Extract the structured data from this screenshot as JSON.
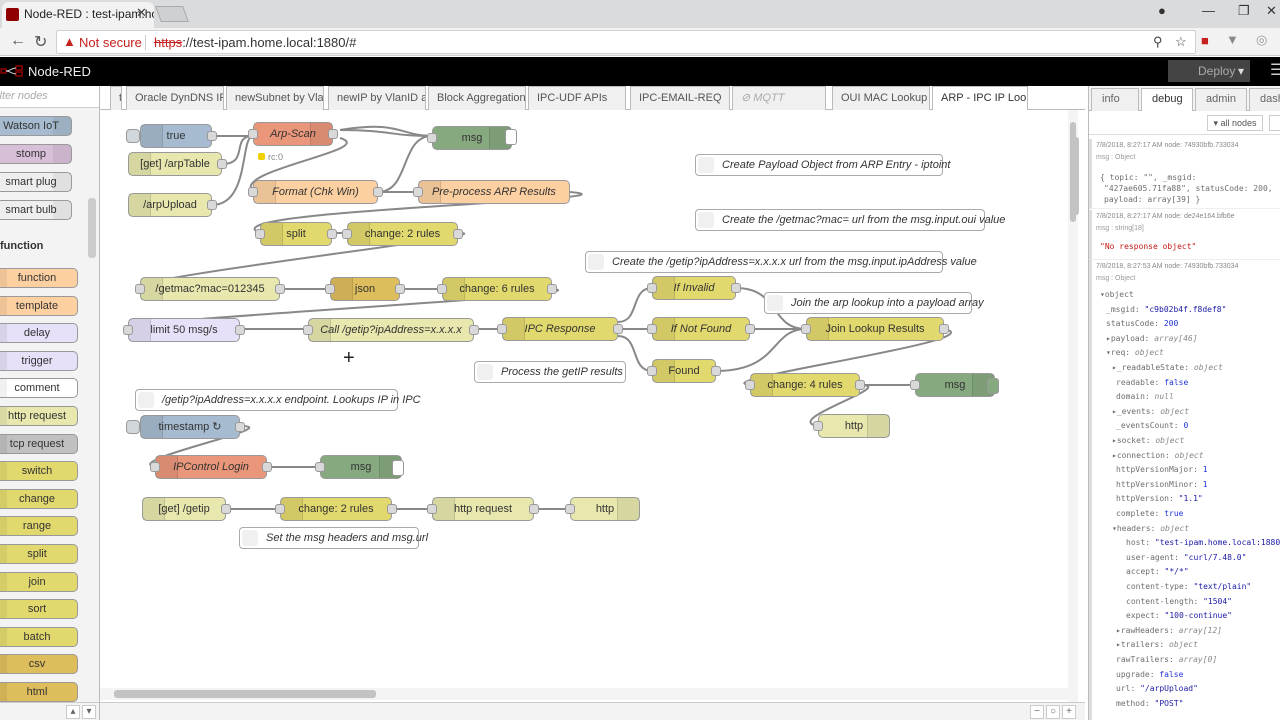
{
  "browser": {
    "tab_title": "Node-RED : test-ipam.ho",
    "security": "Not secure",
    "url_scheme": "https",
    "url_rest": "://test-ipam.home.local:1880/#"
  },
  "header": {
    "app_title": "Node-RED",
    "deploy_label": "Deploy"
  },
  "palette": {
    "search_placeholder": "filter nodes",
    "category": "function",
    "top_nodes": [
      {
        "label": "Watson IoT",
        "color": "#a6bbcf"
      },
      {
        "label": "stomp",
        "color": "#d8bfd8"
      },
      {
        "label": "smart plug",
        "color": "#eeeeee"
      },
      {
        "label": "smart bulb",
        "color": "#eeeeee"
      }
    ],
    "nodes": [
      {
        "label": "function",
        "color": "#fdd0a2"
      },
      {
        "label": "template",
        "color": "#fdd0a2"
      },
      {
        "label": "delay",
        "color": "#e6e0f8"
      },
      {
        "label": "trigger",
        "color": "#e6e0f8"
      },
      {
        "label": "comment",
        "color": "#ffffff"
      },
      {
        "label": "http request",
        "color": "#e7e7ae"
      },
      {
        "label": "tcp request",
        "color": "#c0c0c0"
      },
      {
        "label": "switch",
        "color": "#e2d96e"
      },
      {
        "label": "change",
        "color": "#e2d96e"
      },
      {
        "label": "range",
        "color": "#e2d96e"
      },
      {
        "label": "split",
        "color": "#e2d96e"
      },
      {
        "label": "join",
        "color": "#e2d96e"
      },
      {
        "label": "sort",
        "color": "#e2d96e"
      },
      {
        "label": "batch",
        "color": "#e2d96e"
      },
      {
        "label": "csv",
        "color": "#debd5c"
      },
      {
        "label": "html",
        "color": "#debd5c"
      }
    ]
  },
  "workspace_tabs": [
    {
      "label": "t",
      "state": "normal"
    },
    {
      "label": "Oracle DynDNS IPC",
      "state": "normal"
    },
    {
      "label": "newSubnet by Vlan",
      "state": "normal"
    },
    {
      "label": "newIP by VlanID and",
      "state": "normal"
    },
    {
      "label": "Block Aggregation U",
      "state": "normal"
    },
    {
      "label": "IPC-UDF APIs",
      "state": "normal"
    },
    {
      "label": "IPC-EMAIL-REQ",
      "state": "normal"
    },
    {
      "label": "MQTT",
      "state": "disabled"
    },
    {
      "label": "OUI MAC Lookup",
      "state": "normal"
    },
    {
      "label": "ARP - IPC IP Looku",
      "state": "active"
    }
  ],
  "flow_nodes": [
    {
      "label": "true",
      "color": "#a6bbcf"
    },
    {
      "label": "Arp-Scan",
      "color": "#e9967a"
    },
    {
      "label": "msg",
      "color": "#87a980"
    },
    {
      "label": "[get] /arpTable",
      "color": "#e7e7ae"
    },
    {
      "label": "Format (Chk Win)",
      "color": "#fdd0a2"
    },
    {
      "label": "Pre-process ARP Results",
      "color": "#fdd0a2"
    },
    {
      "label": "/arpUpload",
      "color": "#e7e7ae"
    },
    {
      "label": "split",
      "color": "#e2d96e"
    },
    {
      "label": "change: 2 rules",
      "color": "#e2d96e"
    },
    {
      "label": "/getmac?mac=012345",
      "color": "#e7e7ae"
    },
    {
      "label": "json",
      "color": "#debd5c"
    },
    {
      "label": "change: 6 rules",
      "color": "#e2d96e"
    },
    {
      "label": "limit 50 msg/s",
      "color": "#e6e0f8"
    },
    {
      "label": "Call /getip?ipAddress=x.x.x.x",
      "color": "#e7e7ae"
    },
    {
      "label": "IPC Response",
      "color": "#e2d96e"
    },
    {
      "label": "If Invalid",
      "color": "#e2d96e"
    },
    {
      "label": "If Not Found",
      "color": "#e2d96e"
    },
    {
      "label": "Found",
      "color": "#e2d96e"
    },
    {
      "label": "Join Lookup Results",
      "color": "#e2d96e"
    },
    {
      "label": "change: 4 rules",
      "color": "#e2d96e"
    },
    {
      "label": "msg",
      "color": "#87a980"
    },
    {
      "label": "http",
      "color": "#e7e7ae"
    },
    {
      "label": "timestamp ↻",
      "color": "#a6bbcf"
    },
    {
      "label": "IPControl Login",
      "color": "#e9967a"
    },
    {
      "label": "msg",
      "color": "#87a980"
    },
    {
      "label": "[get] /getip",
      "color": "#e7e7ae"
    },
    {
      "label": "change: 2 rules",
      "color": "#e2d96e"
    },
    {
      "label": "http request",
      "color": "#e7e7ae"
    },
    {
      "label": "http",
      "color": "#e7e7ae"
    }
  ],
  "status": {
    "arp_scan": "rc:0"
  },
  "comments": [
    "Create Payload Object from ARP Entry - iptoint",
    "Create the /getmac?mac= url from the msg.input.oui value",
    "Create the /getip?ipAddress=x.x.x.x url from the msg.input.ipAddress value",
    "Join the arp lookup into a payload array",
    "Process the getIP results",
    "/getip?ipAddress=x.x.x.x endpoint. Lookups IP in IPC",
    "Set the msg headers and msg.url"
  ],
  "sidebar": {
    "tabs": [
      "info",
      "debug",
      "admin",
      "dashb"
    ],
    "filter_label": "all nodes",
    "messages": [
      {
        "meta": "7/8/2018, 8:27:17 AM    node: 74930bfb.733034",
        "topic": "msg : Object"
      },
      {
        "meta": "7/8/2018, 8:27:17 AM    node: de24e164.bfb6e",
        "topic": "msg : string[18]"
      },
      {
        "meta": "7/8/2018, 8:27:53 AM    node: 74930bfb.733034",
        "topic": "msg : Object"
      }
    ],
    "msg1_summary_1": "{ topic: \"\", _msgid:",
    "msg1_summary_2": "\"427ae605.71fa88\", statusCode: 200,",
    "msg1_summary_3": "payload: array[39] }",
    "msg2_value": "\"No response object\"",
    "tree": [
      {
        "k": "▾object",
        "v": ""
      },
      {
        "k": "_msgid:",
        "v": "\"c9b02b4f.f8def8\""
      },
      {
        "k": "statusCode:",
        "v": "200"
      },
      {
        "k": "▸payload:",
        "v": "array[46]"
      },
      {
        "k": "▾req:",
        "v": "object"
      },
      {
        "k": "▸_readableState:",
        "v": "object"
      },
      {
        "k": "readable:",
        "v": "false"
      },
      {
        "k": "domain:",
        "v": "null"
      },
      {
        "k": "▸_events:",
        "v": "object"
      },
      {
        "k": "_eventsCount:",
        "v": "0"
      },
      {
        "k": "▸socket:",
        "v": "object"
      },
      {
        "k": "▸connection:",
        "v": "object"
      },
      {
        "k": "httpVersionMajor:",
        "v": "1"
      },
      {
        "k": "httpVersionMinor:",
        "v": "1"
      },
      {
        "k": "httpVersion:",
        "v": "\"1.1\""
      },
      {
        "k": "complete:",
        "v": "true"
      },
      {
        "k": "▾headers:",
        "v": "object"
      },
      {
        "k": "host:",
        "v": "\"test-ipam.home.local:1880\""
      },
      {
        "k": "user-agent:",
        "v": "\"curl/7.48.0\""
      },
      {
        "k": "accept:",
        "v": "\"*/*\""
      },
      {
        "k": "content-type:",
        "v": "\"text/plain\""
      },
      {
        "k": "content-length:",
        "v": "\"1504\""
      },
      {
        "k": "expect:",
        "v": "\"100-continue\""
      },
      {
        "k": "▸rawHeaders:",
        "v": "array[12]"
      },
      {
        "k": "▸trailers:",
        "v": "object"
      },
      {
        "k": "rawTrailers:",
        "v": "array[0]"
      },
      {
        "k": "upgrade:",
        "v": "false"
      },
      {
        "k": "url:",
        "v": "\"/arpUpload\""
      },
      {
        "k": "method:",
        "v": "\"POST\""
      }
    ]
  }
}
